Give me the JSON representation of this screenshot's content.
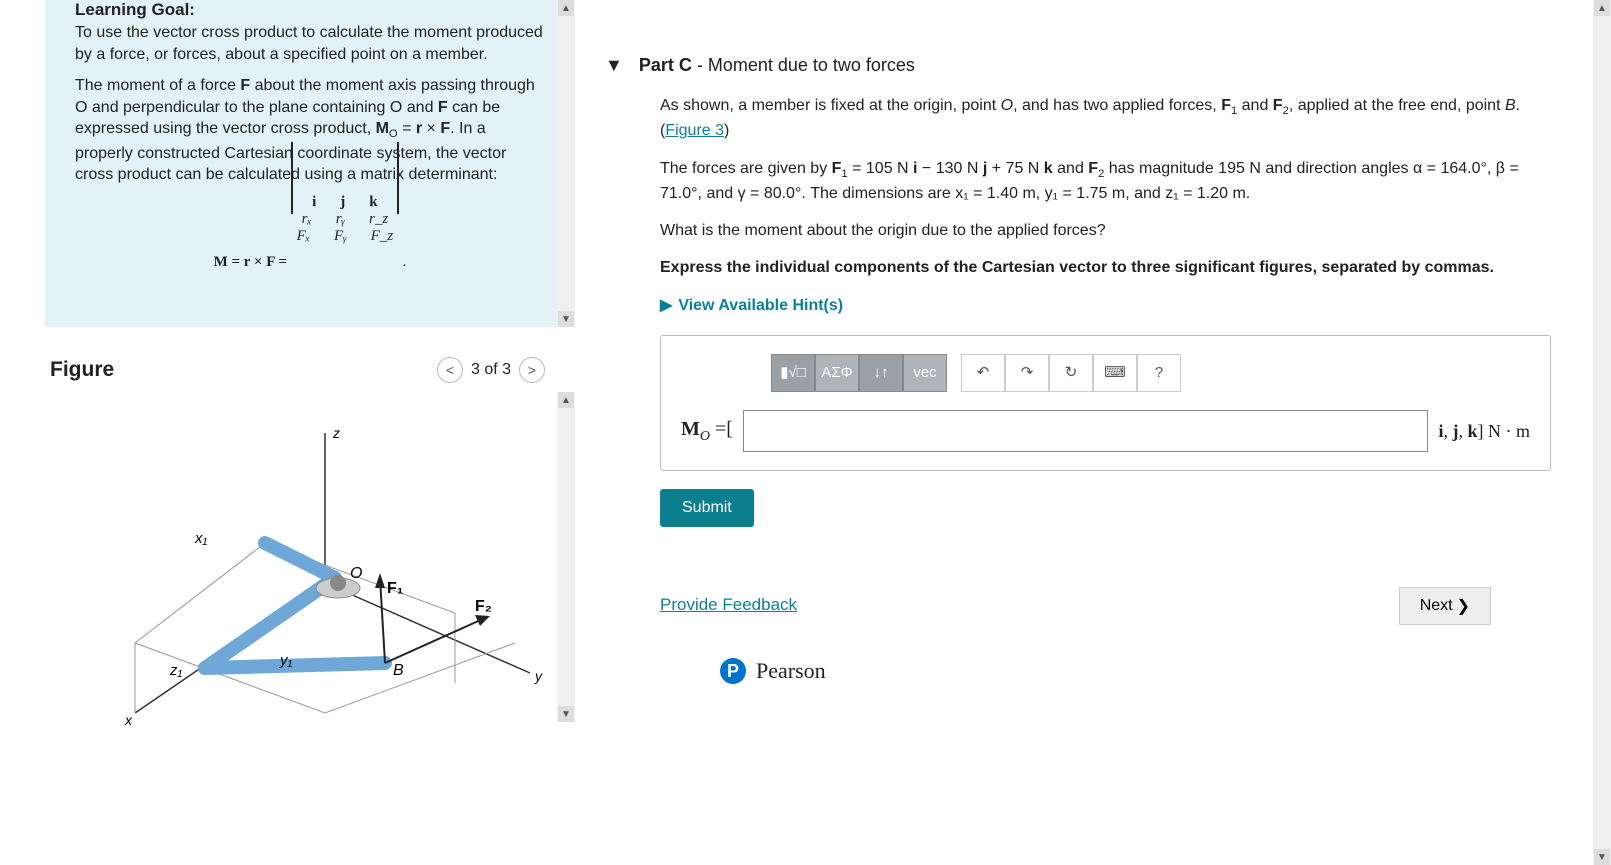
{
  "left": {
    "goal_title": "Learning Goal:",
    "goal_body": "To use the vector cross product to calculate the moment produced by a force, or forces, about a specified point on a member.",
    "goal_p2_a": "The moment of a force ",
    "goal_p2_b": " about the moment axis passing through O and perpendicular to the plane containing O and ",
    "goal_p2_c": " can be expressed using the vector cross product, ",
    "goal_p2_d": ". In a properly constructed Cartesian coordinate system, the vector cross product can be calculated using a matrix determinant:",
    "matrix_lhs": "M = r × F =",
    "matrix": {
      "r1": [
        "i",
        "j",
        "k"
      ],
      "r2": [
        "rₓ",
        "rᵧ",
        "r_z"
      ],
      "r3": [
        "Fₓ",
        "Fᵧ",
        "F_z"
      ]
    },
    "figure_title": "Figure",
    "figure_nav_prev": "<",
    "figure_nav_label": "3 of 3",
    "figure_nav_next": ">",
    "diagram": {
      "axes": [
        "x",
        "y",
        "z"
      ],
      "dims": [
        "x₁",
        "y₁",
        "z₁"
      ],
      "points": [
        "O",
        "B"
      ],
      "forces": [
        "F₁",
        "F₂"
      ]
    }
  },
  "right": {
    "part_label": "Part C",
    "part_title": " - Moment due to two forces",
    "intro_a": "As shown, a member is fixed at the origin, point ",
    "intro_b": ", and has two applied forces, ",
    "intro_c": ", applied at the free end, point ",
    "intro_d": ".",
    "figure_link": "Figure 3",
    "forces_a": "The forces are given by ",
    "forces_b": " has magnitude ",
    "forces_c": " and direction angles ",
    "forces_d": ". The dimensions are ",
    "values": {
      "F1": "F₁ = 105 N i − 130 N j + 75 N k",
      "F2": "F₂",
      "F2_mag": "195 N",
      "alpha": "α = 164.0°",
      "beta": "β = 71.0°",
      "gamma": "γ = 80.0°",
      "x1": "x₁ = 1.40 m",
      "y1": "y₁ = 1.75 m",
      "z1": "z₁ = 1.20 m"
    },
    "question": "What is the moment about the origin due to the applied forces?",
    "instruction": "Express the individual components of the Cartesian vector to three significant figures, separated by commas.",
    "hints_label": "View Available Hint(s)",
    "toolbar": {
      "template": "▮√□",
      "greek": "ΑΣΦ",
      "updown": "↓↑",
      "vec": "vec",
      "undo": "↶",
      "redo": "↷",
      "reset": "↻",
      "keyboard": "⌨",
      "help": "?"
    },
    "answer_lhs": "M_O = [",
    "answer_placeholder": "",
    "answer_rhs": "i, j, k] N · m",
    "submit": "Submit",
    "feedback": "Provide Feedback",
    "next": "Next",
    "pearson": "Pearson"
  }
}
